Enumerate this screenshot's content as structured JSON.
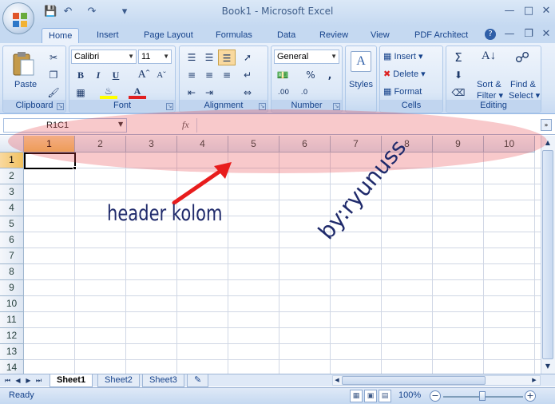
{
  "window": {
    "title": "Book1 - Microsoft Excel"
  },
  "quick_access": {
    "icons": [
      "save-icon",
      "undo-icon",
      "redo-icon",
      "customize-icon"
    ]
  },
  "tabs": [
    {
      "label": "Home",
      "active": true
    },
    {
      "label": "Insert"
    },
    {
      "label": "Page Layout"
    },
    {
      "label": "Formulas"
    },
    {
      "label": "Data"
    },
    {
      "label": "Review"
    },
    {
      "label": "View"
    },
    {
      "label": "PDF Architect"
    }
  ],
  "ribbon": {
    "clipboard": {
      "label": "Clipboard",
      "paste": "Paste"
    },
    "font": {
      "label": "Font",
      "family": "Calibri",
      "size": "11"
    },
    "alignment": {
      "label": "Alignment"
    },
    "number": {
      "label": "Number",
      "format": "General"
    },
    "styles": {
      "label": "Styles"
    },
    "cells": {
      "label": "Cells",
      "insert": "Insert",
      "delete": "Delete",
      "format": "Format"
    },
    "editing": {
      "label": "Editing",
      "sort": "Sort &",
      "filter": "Filter",
      "find": "Find &",
      "select": "Select"
    }
  },
  "formula_bar": {
    "name_box": "R1C1",
    "fx": "fx",
    "value": ""
  },
  "grid": {
    "columns": [
      "1",
      "2",
      "3",
      "4",
      "5",
      "6",
      "7",
      "8",
      "9",
      "10"
    ],
    "rows": [
      "1",
      "2",
      "3",
      "4",
      "5",
      "6",
      "7",
      "8",
      "9",
      "10",
      "11",
      "12",
      "13",
      "14"
    ],
    "active_cell": "R1C1"
  },
  "sheets": [
    {
      "label": "Sheet1",
      "active": true
    },
    {
      "label": "Sheet2"
    },
    {
      "label": "Sheet3"
    }
  ],
  "status": {
    "text": "Ready",
    "zoom": "100%"
  },
  "annotations": {
    "label": "header kolom",
    "watermark": "by:ryunuss"
  },
  "colors": {
    "accent": "#15428b",
    "highlight": "#f1c15f",
    "annotation_fill": "#e63c46",
    "annotation_text": "#1f2a6b"
  }
}
